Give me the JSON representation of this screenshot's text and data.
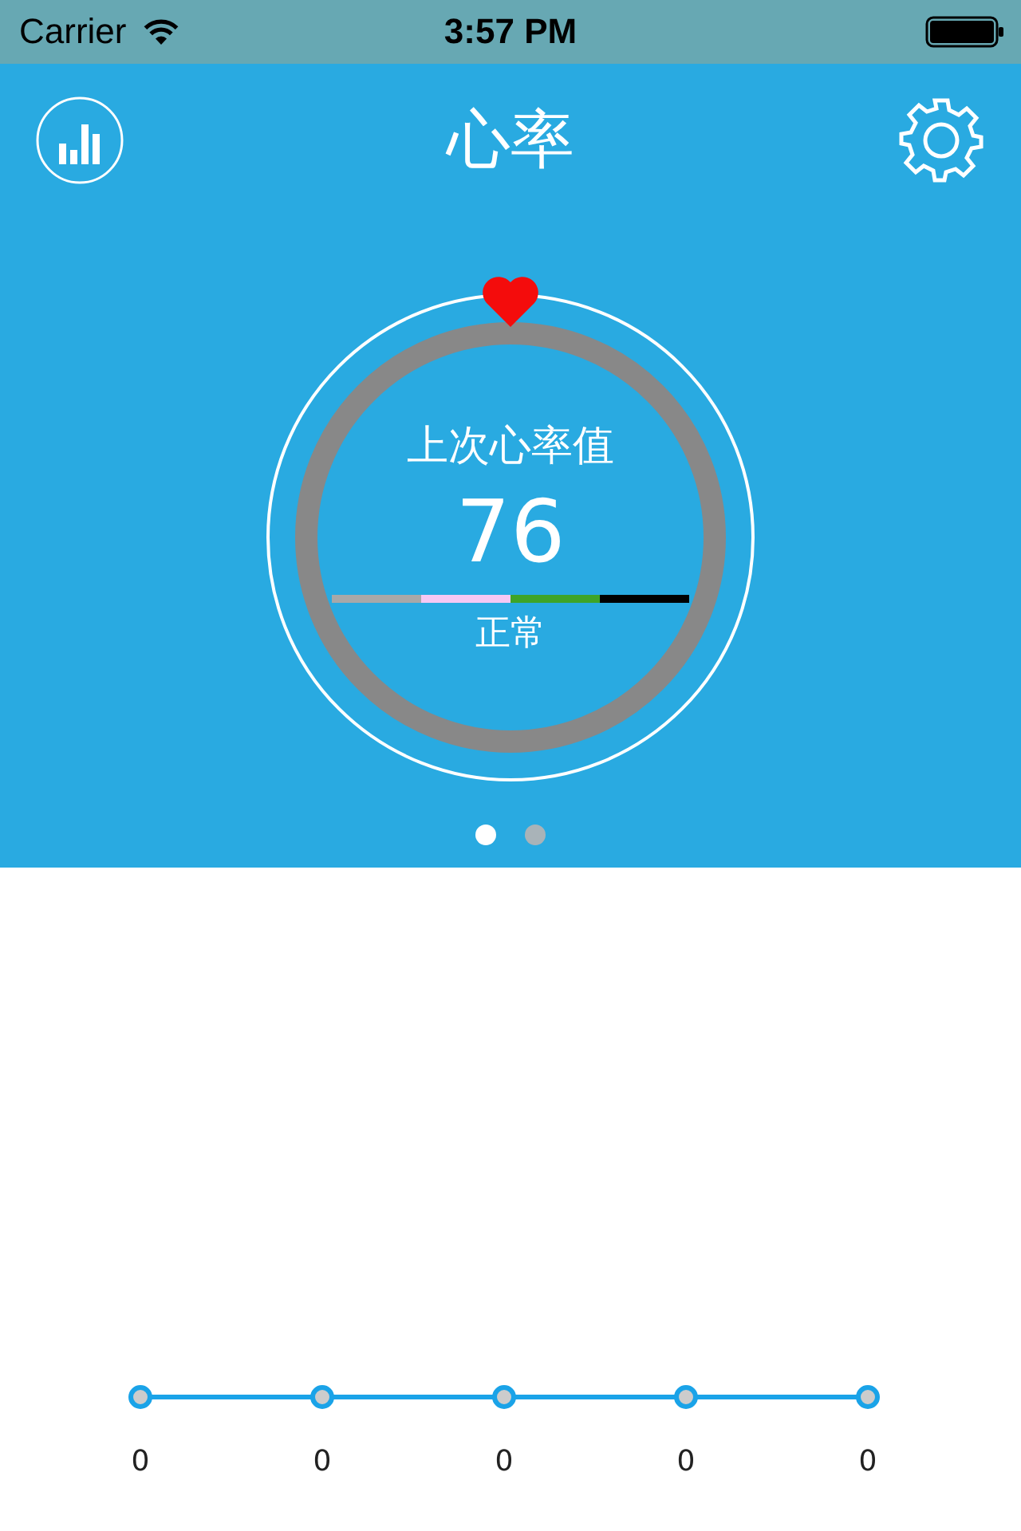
{
  "status_bar": {
    "carrier": "Carrier",
    "time": "3:57 PM"
  },
  "header": {
    "title": "心率"
  },
  "gauge": {
    "label": "上次心率值",
    "value": "76",
    "status": "正常",
    "scale": [
      {
        "color": "#a8a8a8"
      },
      {
        "color": "#f6c8f4"
      },
      {
        "color": "#3ea428"
      },
      {
        "color": "#000000"
      }
    ]
  },
  "pager": [
    {
      "selected": true
    },
    {
      "selected": false
    }
  ],
  "trend": {
    "points": [
      {
        "reading": "0"
      },
      {
        "reading": "0"
      },
      {
        "reading": "0"
      },
      {
        "reading": "0"
      },
      {
        "reading": "0"
      }
    ]
  }
}
